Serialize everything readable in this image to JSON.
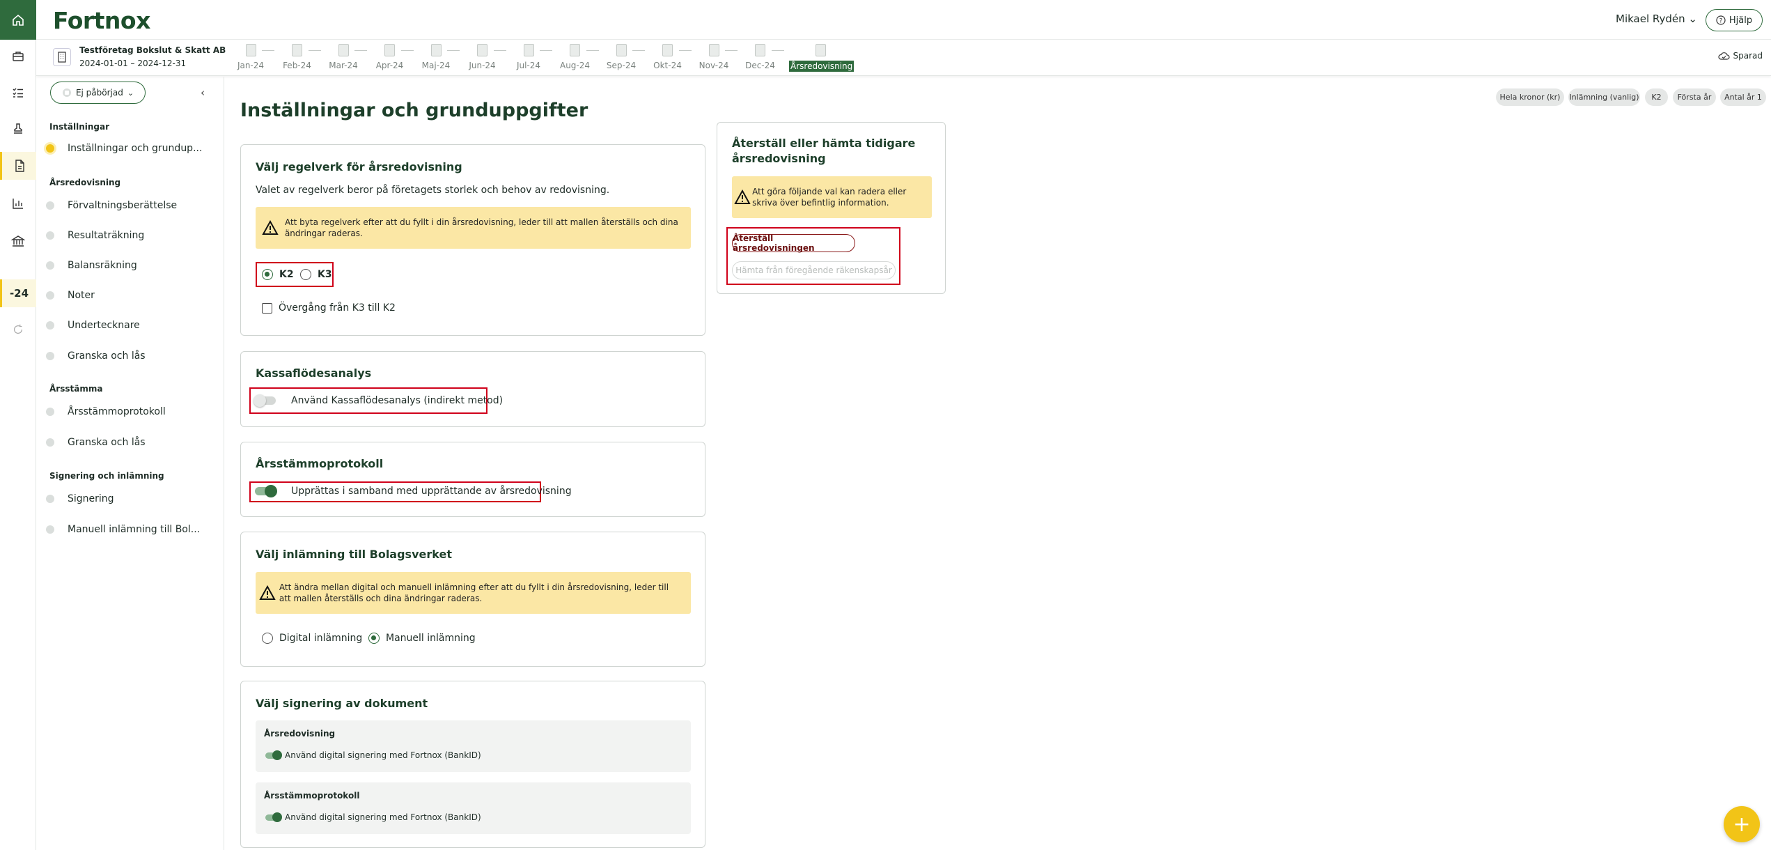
{
  "header": {
    "logo": "Fortnox",
    "user_name": "Mikael Rydén",
    "help_label": "Hjälp",
    "company_name": "Testföretag Bokslut & Skatt AB",
    "period": "2024-01-01 – 2024-12-31",
    "saved_label": "Sparad"
  },
  "rail": {
    "year_label": "-24"
  },
  "timeline": [
    "Jan-24",
    "Feb-24",
    "Mar-24",
    "Apr-24",
    "Maj-24",
    "Jun-24",
    "Jul-24",
    "Aug-24",
    "Sep-24",
    "Okt-24",
    "Nov-24",
    "Dec-24",
    "Årsredovisning"
  ],
  "sidebar": {
    "status": "Ej påbörjad",
    "sections": [
      {
        "title": "Inställningar",
        "items": [
          "Inställningar och grundup..."
        ]
      },
      {
        "title": "Årsredovisning",
        "items": [
          "Förvaltningsberättelse",
          "Resultaträkning",
          "Balansräkning",
          "Noter",
          "Undertecknare",
          "Granska och lås"
        ]
      },
      {
        "title": "Årsstämma",
        "items": [
          "Årsstämmoprotokoll",
          "Granska och lås"
        ]
      },
      {
        "title": "Signering och inlämning",
        "items": [
          "Signering",
          "Manuell inlämning till Bol..."
        ]
      }
    ]
  },
  "chips": [
    "Hela kronor (kr)",
    "Inlämning (vanlig)",
    "K2",
    "Första år",
    "Antal år 1"
  ],
  "main": {
    "title": "Inställningar och grunduppgifter",
    "regelverk": {
      "title": "Välj regelverk för årsredovisning",
      "description": "Valet av regelverk beror på företagets storlek och behov av redovisning.",
      "warning": "Att byta regelverk efter att du fyllt i din årsredovisning, leder till att mallen återställs och dina ändringar raderas.",
      "option_k2": "K2",
      "option_k3": "K3",
      "selected": "K2",
      "checkbox_label": "Övergång från K3 till K2"
    },
    "kassaflode": {
      "title": "Kassaflödesanalys",
      "toggle_label": "Använd Kassaflödesanalys (indirekt metod)",
      "enabled": false
    },
    "arsstamma": {
      "title": "Årsstämmoprotokoll",
      "toggle_label": "Upprättas i samband med upprättande av årsredovisning",
      "enabled": true
    },
    "inlamning": {
      "title": "Välj inlämning till Bolagsverket",
      "warning": "Att ändra mellan digital och manuell inlämning efter att du fyllt i din årsredovisning, leder till att mallen återställs och dina ändringar raderas.",
      "option_digital": "Digital inlämning",
      "option_manual": "Manuell inlämning",
      "selected": "Manuell inlämning"
    },
    "signering": {
      "title": "Välj signering av dokument",
      "box1_title": "Årsredovisning",
      "box1_label": "Använd digital signering med Fortnox (BankID)",
      "box2_title": "Årsstämmoprotokoll",
      "box2_label": "Använd digital signering med Fortnox (BankID)"
    }
  },
  "restore": {
    "title": "Återställ eller hämta tidigare årsredovisning",
    "warning": "Att göra följande val kan radera eller skriva över befintlig information.",
    "reset_button": "Återställ årsredovisningen",
    "fetch_button": "Hämta från föregående räkenskapsår"
  },
  "colors": {
    "brand_green": "#2f6b3d",
    "accent_yellow": "#f2c417",
    "warning_bg": "#fbe7a5",
    "highlight_red": "#d0021b"
  }
}
